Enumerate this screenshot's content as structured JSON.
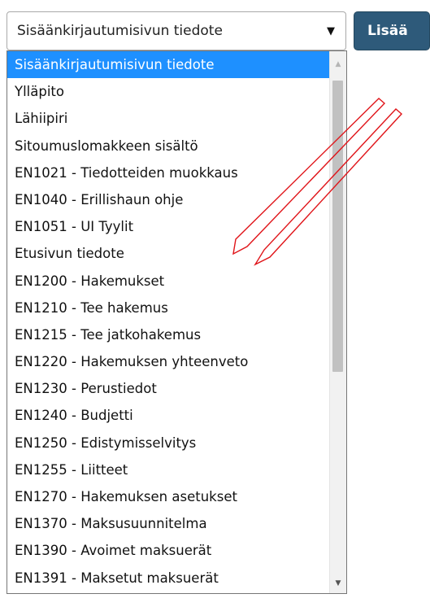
{
  "select": {
    "value": "Sisäänkirjautumisivun tiedote",
    "arrow_icon": "▼"
  },
  "add_button": {
    "label": "Lisää"
  },
  "dropdown": {
    "options": [
      "Sisäänkirjautumisivun tiedote",
      "Ylläpito",
      "Lähiipiri",
      "Sitoumuslomakkeen sisältö",
      "EN1021 - Tiedotteiden muokkaus",
      "EN1040 - Erillishaun ohje",
      "EN1051 - UI Tyylit",
      "Etusivun tiedote",
      "EN1200 - Hakemukset",
      "EN1210 - Tee hakemus",
      "EN1215 - Tee jatkohakemus",
      "EN1220 - Hakemuksen yhteenveto",
      "EN1230 - Perustiedot",
      "EN1240 - Budjetti",
      "EN1250 - Edistymisselvitys",
      "EN1255 - Liitteet",
      "EN1270 - Hakemuksen asetukset",
      "EN1370 - Maksusuunnitelma",
      "EN1390 - Avoimet maksuerät",
      "EN1391 - Maksetut maksuerät"
    ],
    "selected_index": 0,
    "highlight_color": "#1e90ff"
  },
  "scrollbar": {
    "up_icon": "▲",
    "down_icon": "▼"
  },
  "annotation": {
    "arrow_color": "#e0151a"
  }
}
